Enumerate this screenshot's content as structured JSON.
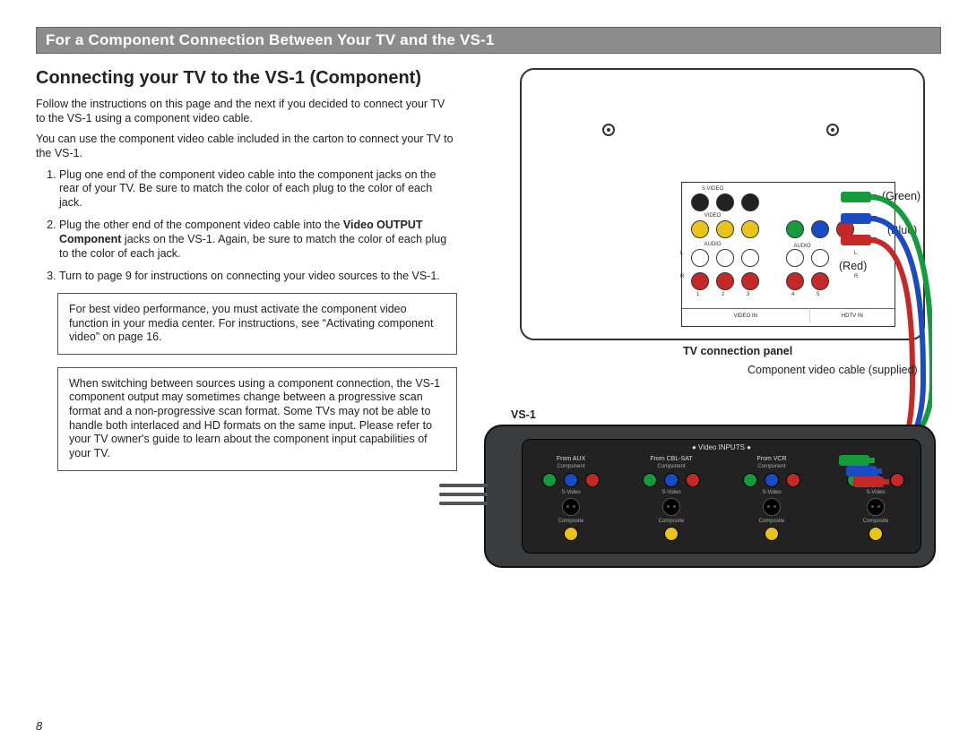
{
  "page_number": "8",
  "header": "For a Component Connection Between Your TV and the VS-1",
  "title": "Connecting your TV to the VS-1 (Component)",
  "intro1": "Follow the instructions on this page and the next if you decided to connect your TV to the VS-1 using a component video cable.",
  "intro2": "You can use the component video cable included in the carton to connect your TV to the VS-1.",
  "steps": {
    "s1": "Plug one end of the component video cable into the component jacks on the rear of your TV. Be sure to match the color of each plug to the color of each jack.",
    "s2a": "Plug the other end of the component video cable into the ",
    "s2b": "Video OUTPUT Component",
    "s2c": " jacks on the VS-1. Again, be sure to match the color of each plug to the color of each jack.",
    "s3": "Turn to page 9 for instructions on connecting your video sources to the VS-1."
  },
  "callout1": "For best video performance, you must activate the component video function in your media center. For instructions, see “Activating component video” on page 16.",
  "callout2": "When switching between sources using a component connection, the VS-1 component output may sometimes change between a progressive scan format and a non-progressive scan format. Some TVs may not be able to handle both interlaced and HD formats on the same input. Please refer to your TV owner's guide to learn about the component input capabilities of your TV.",
  "diagram": {
    "cable_green": "(Green)",
    "cable_blue": "(Blue)",
    "cable_red": "(Red)",
    "tv_panel_caption": "TV connection panel",
    "cable_caption": "Component video cable (supplied)",
    "vs1_caption": "VS-1",
    "panel": {
      "svideo": "S VIDEO",
      "video": "VIDEO",
      "audio": "AUDIO",
      "l": "L",
      "r": "R",
      "nums": [
        "1",
        "2",
        "3",
        "4",
        "5"
      ],
      "foot_left": "VIDEO IN",
      "foot_right": "HDTV IN"
    },
    "vs1": {
      "title": "●  Video INPUTS  ●",
      "col1": "From AUX",
      "col2": "From CBL-SAT",
      "col3": "From VCR",
      "sub": "Component",
      "svideo": "S-Video",
      "composite": "Composite"
    }
  }
}
